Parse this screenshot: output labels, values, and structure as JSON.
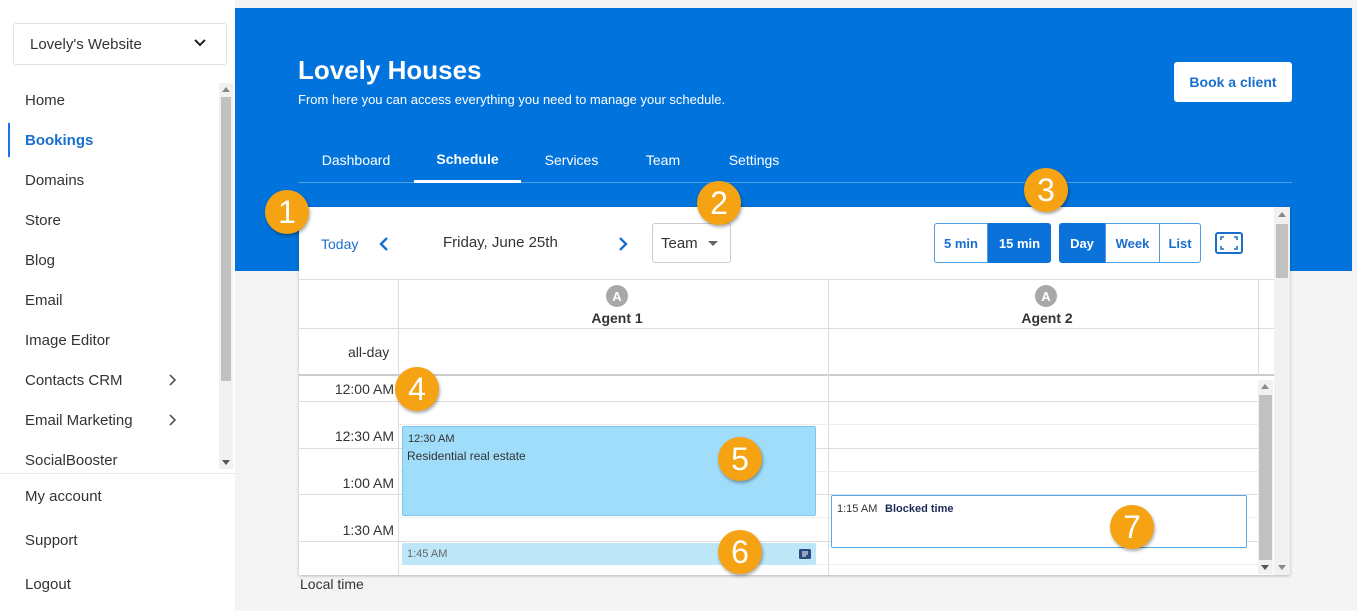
{
  "sidebar": {
    "site_select": "Lovely's Website",
    "items": [
      {
        "label": "Home"
      },
      {
        "label": "Bookings"
      },
      {
        "label": "Domains"
      },
      {
        "label": "Store"
      },
      {
        "label": "Blog"
      },
      {
        "label": "Email"
      },
      {
        "label": "Image Editor"
      },
      {
        "label": "Contacts CRM"
      },
      {
        "label": "Email Marketing"
      },
      {
        "label": "SocialBooster"
      }
    ],
    "bottom": [
      "My account",
      "Support",
      "Logout"
    ]
  },
  "header": {
    "title": "Lovely Houses",
    "subtitle": "From here you can access everything you need to manage your schedule.",
    "book_button": "Book a client",
    "tabs": [
      "Dashboard",
      "Schedule",
      "Services",
      "Team",
      "Settings"
    ],
    "active_tab": "Schedule"
  },
  "calendar": {
    "today": "Today",
    "date": "Friday, June 25th",
    "view_select": "Team",
    "intervals": [
      "5 min",
      "15 min"
    ],
    "active_interval": "15 min",
    "views": [
      "Day",
      "Week",
      "List"
    ],
    "active_view": "Day",
    "agents": [
      {
        "initial": "A",
        "name": "Agent 1"
      },
      {
        "initial": "A",
        "name": "Agent 2"
      }
    ],
    "allday_label": "all-day",
    "times": [
      "12:00 AM",
      "12:30 AM",
      "1:00 AM",
      "1:30 AM"
    ],
    "events": [
      {
        "time": "12:30 AM",
        "name": "Residential real estate"
      },
      {
        "time": "1:45 AM"
      },
      {
        "time": "1:15 AM",
        "name": "Blocked time"
      }
    ],
    "local_time": "Local time"
  },
  "badges": [
    "1",
    "2",
    "3",
    "4",
    "5",
    "6",
    "7"
  ],
  "colors": {
    "brand_blue": "#0073dc",
    "badge_orange": "#f6a313",
    "event_blue": "#9fddfb"
  }
}
